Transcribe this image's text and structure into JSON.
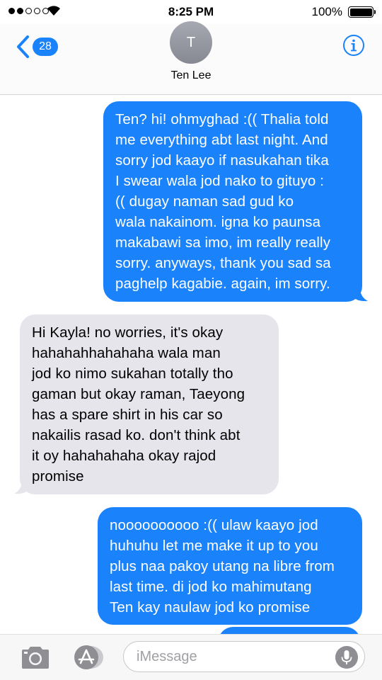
{
  "status_bar": {
    "time": "8:25 PM",
    "battery_percent": "100%",
    "signal_bars_filled": 2,
    "signal_bars_total": 5,
    "battery_level": 1.0
  },
  "header": {
    "back_badge": "28",
    "avatar_initial": "T",
    "contact_name": "Ten Lee",
    "back_icon": "chevron-left-icon",
    "info_icon": "info-icon"
  },
  "messages": [
    {
      "direction": "outgoing",
      "lines": [
        "Ten? hi! ohmyghad :(( Thalia told",
        "me everything abt last night. And",
        "sorry jod kaayo if nasukahan tika",
        "I swear wala jod nako to gituyo :",
        "(( dugay naman sad gud ko",
        "wala nakainom. igna ko paunsa",
        "makabawi sa imo, im really really",
        "sorry. anyways, thank you sad sa",
        "paghelp kagabie. again, im sorry."
      ]
    },
    {
      "direction": "incoming",
      "lines": [
        "Hi Kayla! no worries, it's okay",
        "hahahahhahahaha wala man",
        "jod ko nimo sukahan totally tho",
        "gaman but okay raman, Taeyong",
        "has a spare shirt in his car so",
        "nakailis rasad ko. don't think abt",
        "it oy hahahahaha okay rajod",
        "promise"
      ]
    },
    {
      "direction": "outgoing",
      "lines": [
        "noooooooooo :(( ulaw kaayo jod",
        "huhuhu let me make it up to you",
        "plus naa pakoy utang na libre from",
        "last time. di jod ko mahimutang",
        "Ten kay naulaw jod ko promise"
      ]
    }
  ],
  "input_bar": {
    "placeholder": "iMessage",
    "camera_icon": "camera-icon",
    "appstore_icon": "app-store-icon",
    "mic_icon": "microphone-icon"
  },
  "colors": {
    "outgoing_bubble": "#1a82fb",
    "incoming_bubble": "#e6e5eb",
    "accent": "#1a82fb"
  }
}
